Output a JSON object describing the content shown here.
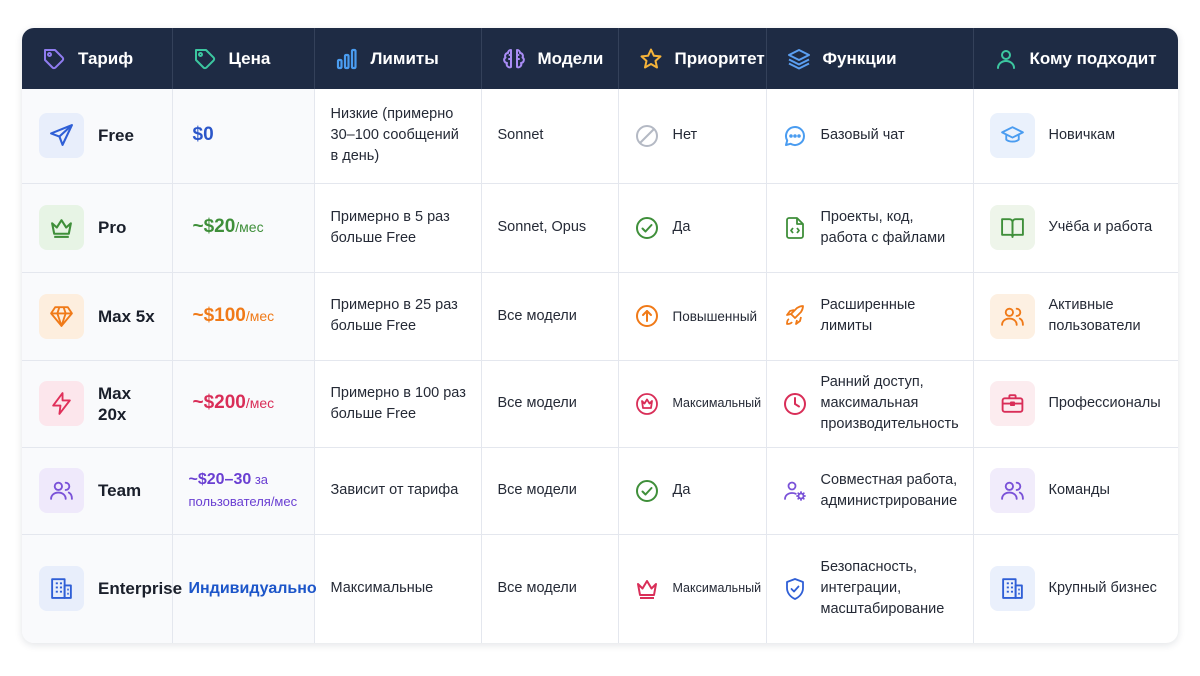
{
  "colors": {
    "header_bg": "#1e2b44",
    "free": "#2f5fd6",
    "pro": "#3f8f3a",
    "max5": "#f07a18",
    "max20": "#e0305a",
    "team": "#7a52d8",
    "enterprise": "#2f5fd6"
  },
  "header": {
    "plan": "Тариф",
    "price": "Цена",
    "limits": "Лимиты",
    "models": "Модели",
    "priority": "Приоритет",
    "features": "Функции",
    "audience": "Кому подходит"
  },
  "rows": [
    {
      "plan": "Free",
      "plan_icon": "paper-plane-icon",
      "price": "$0",
      "price_unit": "",
      "limits": "Низкие (примерно 30–100 сообщений в день)",
      "models": "Sonnet",
      "priority": "Нет",
      "priority_icon": "no-icon",
      "features": "Базовый чат",
      "features_icon": "chat-icon",
      "audience": "Новичкам",
      "audience_icon": "graduation-cap-icon"
    },
    {
      "plan": "Pro",
      "plan_icon": "crown-icon",
      "price": "~$20",
      "price_unit": "/мес",
      "limits": "Примерно в 5 раз больше Free",
      "models": "Sonnet, Opus",
      "priority": "Да",
      "priority_icon": "check-circle-icon",
      "features": "Проекты, код, работа с файлами",
      "features_icon": "code-file-icon",
      "audience": "Учёба и работа",
      "audience_icon": "book-icon"
    },
    {
      "plan": "Max 5x",
      "plan_icon": "diamond-icon",
      "price": "~$100",
      "price_unit": "/мес",
      "limits": "Примерно в 25 раз больше Free",
      "models": "Все модели",
      "priority": "Повышенный",
      "priority_icon": "arrow-up-circle-icon",
      "features": "Расширенные лимиты",
      "features_icon": "rocket-icon",
      "audience": "Активные пользователи",
      "audience_icon": "users-icon"
    },
    {
      "plan": "Max 20x",
      "plan_icon": "lightning-icon",
      "price": "~$200",
      "price_unit": "/мес",
      "limits": "Примерно в 100 раз больше Free",
      "models": "Все модели",
      "priority": "Максимальный",
      "priority_icon": "crown-circle-icon",
      "features": "Ранний доступ, максимальная производительность",
      "features_icon": "clock-icon",
      "audience": "Профессионалы",
      "audience_icon": "briefcase-icon"
    },
    {
      "plan": "Team",
      "plan_icon": "team-icon",
      "price": "~$20–30",
      "price_unit": " за пользователя/мес",
      "limits": "Зависит от тарифа",
      "models": "Все модели",
      "priority": "Да",
      "priority_icon": "check-circle-icon",
      "features": "Совместная работа, администрирование",
      "features_icon": "user-gear-icon",
      "audience": "Команды",
      "audience_icon": "users-icon"
    },
    {
      "plan": "Enterprise",
      "plan_icon": "building-icon",
      "price": "Индивидуально",
      "price_unit": "",
      "limits": "Максимальные",
      "models": "Все модели",
      "priority": "Максимальный",
      "priority_icon": "crown-icon",
      "features": "Безопасность, интеграции, масштабирование",
      "features_icon": "shield-check-icon",
      "audience": "Крупный бизнес",
      "audience_icon": "building-icon"
    }
  ]
}
